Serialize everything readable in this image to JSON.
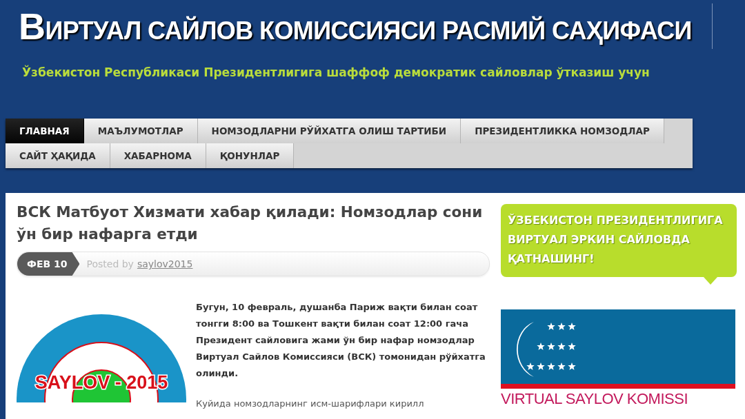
{
  "header": {
    "title": "ВИРТУАЛ САЙЛОВ КОМИССИЯСИ РАСМИЙ САҲИФАСИ",
    "tagline": "Ўзбекистон Республикаси Президентлигига шаффоф демократик сайловлар ўтказиш учун"
  },
  "nav": {
    "rows": [
      [
        {
          "label": "ГЛАВНАЯ",
          "selected": true
        },
        {
          "label": "МАЪЛУМОТЛАР",
          "selected": false
        },
        {
          "label": "НОМЗОДЛАРНИ РЎЙХАТГА ОЛИШ ТАРТИБИ",
          "selected": false
        },
        {
          "label": "ПРЕЗИДЕНТЛИККА НОМЗОДЛАР",
          "selected": false
        }
      ],
      [
        {
          "label": "САЙТ ҲАҚИДА",
          "selected": false
        },
        {
          "label": "ХАБАРНОМА",
          "selected": false
        },
        {
          "label": "ҚОНУНЛАР",
          "selected": false
        }
      ]
    ]
  },
  "post": {
    "title": "ВСК Матбуот Хизмати хабар қилади: Номзодлар сони ўн бир нафарга етди",
    "date": "ФЕВ 10",
    "posted_by": "Posted by",
    "author": "saylov2015",
    "logo_text": "SAYLOV - 2015",
    "paragraphs": [
      "Бугун, 10 февраль, душанба Париж вақти билан соат тонгги 8:00 ва Тошкент вақти билан соат 12:00 гача Президент сайловига жами ўн бир нафар номзодлар Виртуал Сайлов Комиссияси (ВСК) томонидан рўйхатга олинди.",
      "Куйида номзодларнинг исм-шарифлари кирилл"
    ]
  },
  "sidebar": {
    "callout": "ЎЗБЕКИСТОН ПРЕЗИДЕНТЛИГИГА ВИРТУАЛ ЭРКИН САЙЛОВДА ҚАТНАШИНГ!",
    "banner_text": "VIRTUAL SAYLOV KOMISSI"
  }
}
